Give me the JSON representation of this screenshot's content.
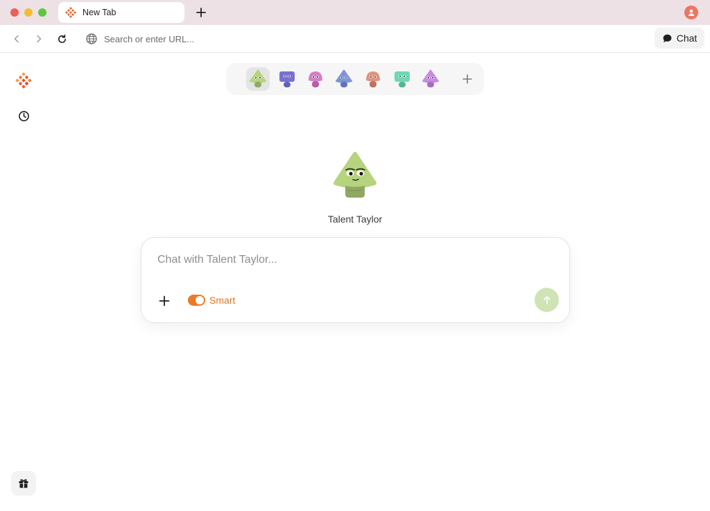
{
  "window": {
    "tab_title": "New Tab"
  },
  "toolbar": {
    "url_placeholder": "Search or enter URL...",
    "chat_label": "Chat"
  },
  "agents": [
    {
      "id": "talent-taylor",
      "shape": "triangle",
      "color": "#b6d37e",
      "selected": true
    },
    {
      "id": "agent-2",
      "shape": "square",
      "color": "#7a6fd3",
      "selected": false
    },
    {
      "id": "agent-3",
      "shape": "round",
      "color": "#d47fc8",
      "selected": false
    },
    {
      "id": "agent-4",
      "shape": "triangle",
      "color": "#7f94d8",
      "selected": false
    },
    {
      "id": "agent-5",
      "shape": "round",
      "color": "#df9480",
      "selected": false
    },
    {
      "id": "agent-6",
      "shape": "square",
      "color": "#6ed8b4",
      "selected": false
    },
    {
      "id": "agent-7",
      "shape": "triangle",
      "color": "#c98be0",
      "selected": false
    }
  ],
  "hero": {
    "agent_name": "Talent Taylor"
  },
  "composer": {
    "placeholder": "Chat with Talent Taylor...",
    "smart_label": "Smart",
    "smart_enabled": true
  },
  "colors": {
    "titlebar_bg": "#ede1e6",
    "accent_orange": "#ee7a24",
    "send_button": "#cfe3b4",
    "profile": "#ea7664"
  },
  "icons": {
    "tab": "logo-icon",
    "new_tab": "plus-icon",
    "profile": "user-icon",
    "back": "chevron-left-icon",
    "forward": "chevron-right-icon",
    "reload": "reload-icon",
    "url": "globe-icon",
    "chat": "chat-bubble-icon",
    "history": "clock-icon",
    "gift": "gift-icon",
    "attach": "plus-icon",
    "send": "arrow-up-icon"
  }
}
